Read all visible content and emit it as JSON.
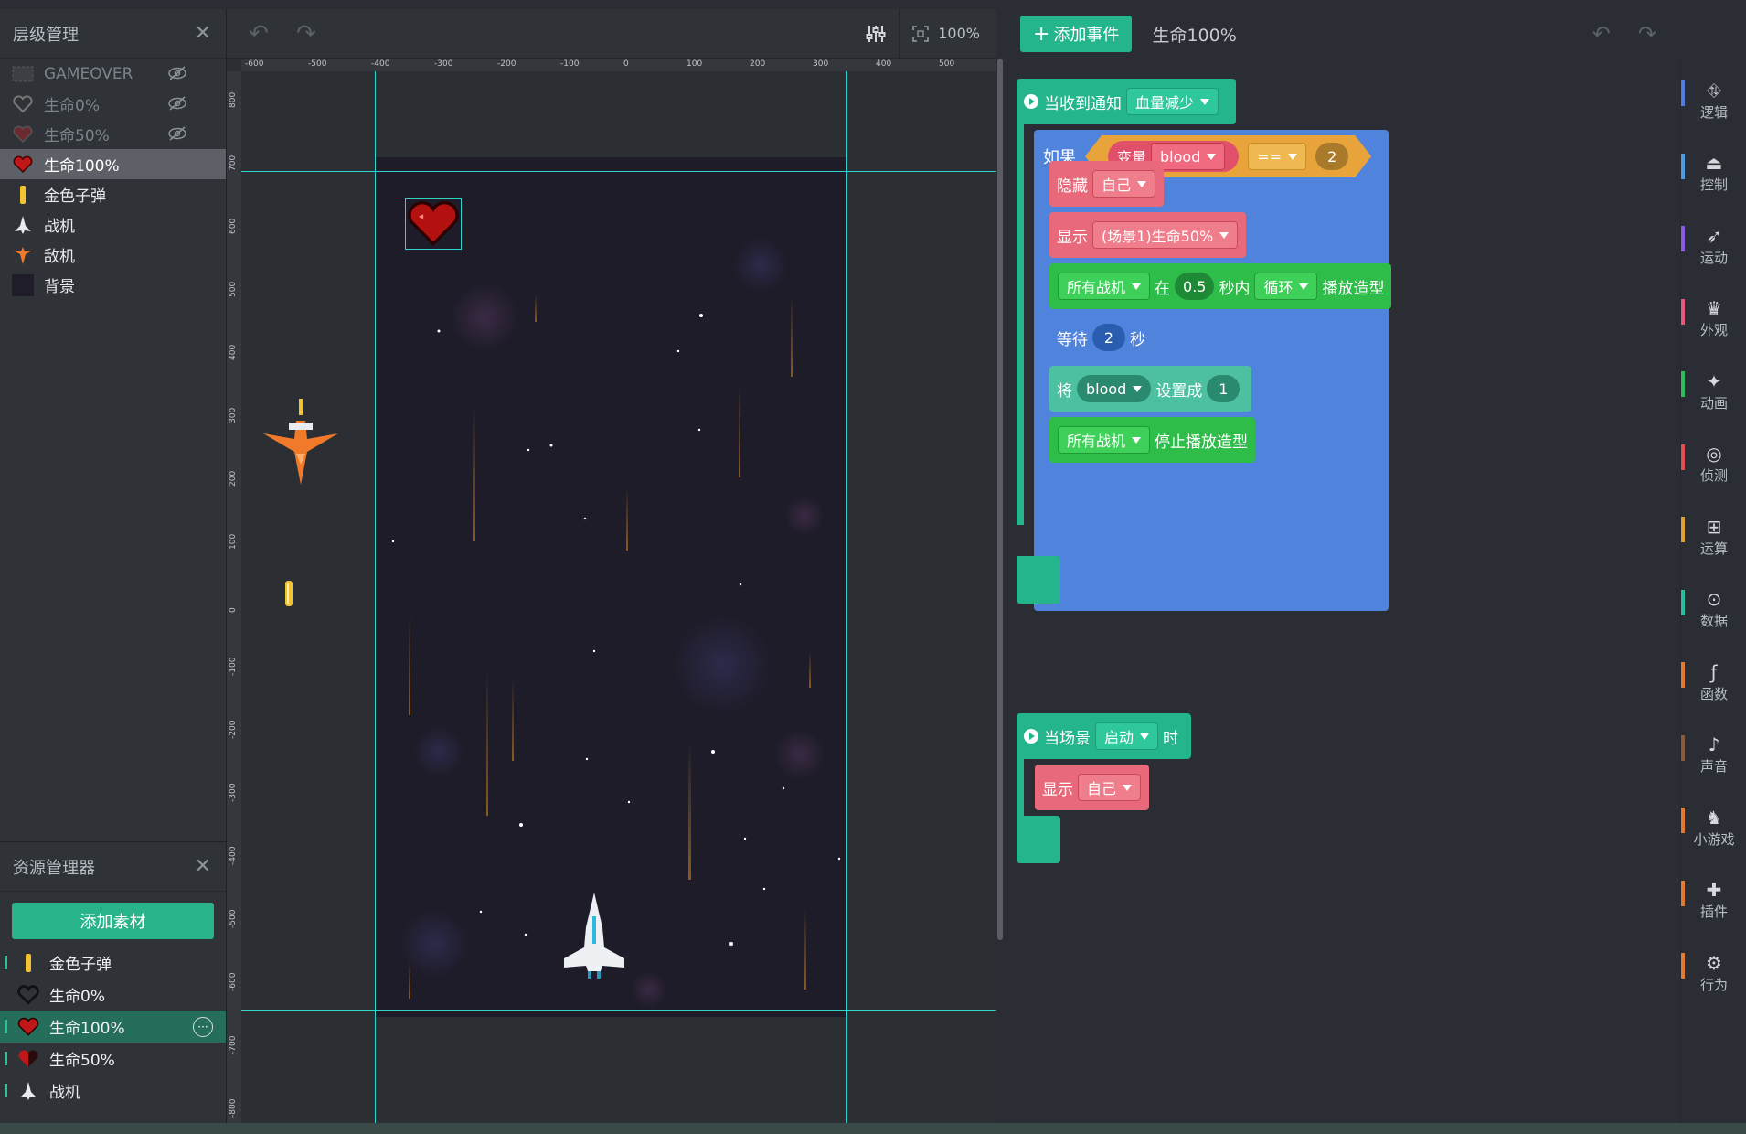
{
  "layers_panel": {
    "title": "层级管理",
    "items": [
      {
        "label": "GAMEOVER",
        "hidden": true
      },
      {
        "label": "生命0%",
        "hidden": true
      },
      {
        "label": "生命50%",
        "hidden": true
      },
      {
        "label": "生命100%",
        "selected": true
      },
      {
        "label": "金色子弹"
      },
      {
        "label": "战机"
      },
      {
        "label": "敌机"
      },
      {
        "label": "背景"
      }
    ]
  },
  "assets_panel": {
    "title": "资源管理器",
    "add_label": "添加素材",
    "items": [
      {
        "label": "金色子弹"
      },
      {
        "label": "生命0%"
      },
      {
        "label": "生命100%",
        "selected": true
      },
      {
        "label": "生命50%"
      },
      {
        "label": "战机"
      }
    ]
  },
  "stage": {
    "zoom": "100%",
    "ruler_x": [
      "-600",
      "-500",
      "-400",
      "-300",
      "-200",
      "-100",
      "0",
      "100",
      "200",
      "300",
      "400",
      "500"
    ],
    "ruler_y": [
      "800",
      "700",
      "600",
      "500",
      "400",
      "300",
      "200",
      "100",
      "0",
      "-100",
      "-200",
      "-300",
      "-400",
      "-500",
      "-600",
      "-700",
      "-800"
    ]
  },
  "code": {
    "add_event_label": "添加事件",
    "title": "生命100%",
    "event1": {
      "hat": "当收到通知",
      "message": "血量减少",
      "if_label": "如果",
      "var_label": "变量",
      "var_name": "blood",
      "op": "==",
      "value": "2",
      "hide": "隐藏",
      "self": "自己",
      "show": "显示",
      "show_target": "(场景1)生命50%",
      "all_fighters": "所有战机",
      "in": "在",
      "seconds_val": "0.5",
      "within": "秒内",
      "loop": "循环",
      "play_costume": "播放造型",
      "wait": "等待",
      "wait_val": "2",
      "sec": "秒",
      "set_prefix": "将",
      "set_var": "blood",
      "set_to": "设置成",
      "set_val": "1",
      "stop_costume": "停止播放造型"
    },
    "event2": {
      "hat": "当场景",
      "scene_event": "启动",
      "when": "时",
      "show": "显示",
      "self": "自己"
    }
  },
  "categories": [
    {
      "label": "逻辑",
      "color": "#4d7ee0",
      "icon": "logic-icon"
    },
    {
      "label": "控制",
      "color": "#4d9be0",
      "icon": "control-icon"
    },
    {
      "label": "运动",
      "color": "#8a5ae0",
      "icon": "motion-icon"
    },
    {
      "label": "外观",
      "color": "#e05a7a",
      "icon": "looks-icon"
    },
    {
      "label": "动画",
      "color": "#2bbd5a",
      "icon": "animation-icon"
    },
    {
      "label": "侦测",
      "color": "#e05050",
      "icon": "sensing-icon"
    },
    {
      "label": "运算",
      "color": "#e0a030",
      "icon": "operator-icon"
    },
    {
      "label": "数据",
      "color": "#2bbda0",
      "icon": "data-icon"
    },
    {
      "label": "函数",
      "color": "#e07a30",
      "icon": "function-icon"
    },
    {
      "label": "声音",
      "color": "#8a5a3a",
      "icon": "sound-icon"
    },
    {
      "label": "小游戏",
      "color": "#e07a30",
      "icon": "minigame-icon"
    },
    {
      "label": "插件",
      "color": "#e07a30",
      "icon": "plugin-icon"
    },
    {
      "label": "行为",
      "color": "#e07a30",
      "icon": "behavior-icon"
    }
  ]
}
